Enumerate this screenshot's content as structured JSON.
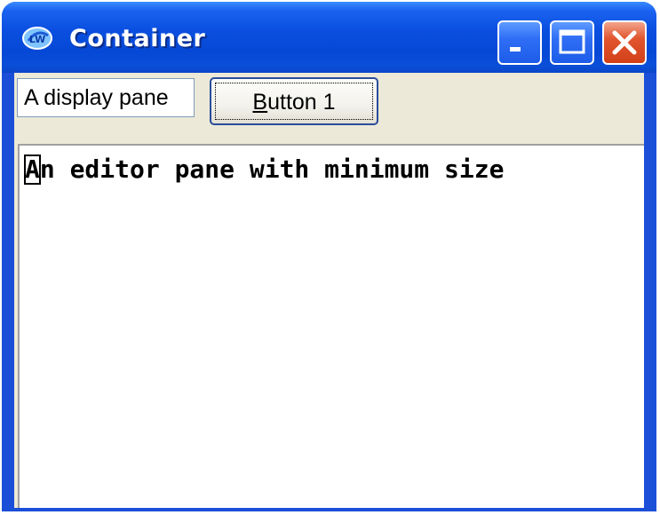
{
  "window": {
    "title": "Container",
    "app_icon": "labwindows-icon",
    "controls": {
      "minimize_icon": "minimize-icon",
      "maximize_icon": "maximize-icon",
      "close_icon": "close-icon"
    },
    "colors": {
      "titlebar": "#0648d6",
      "client_bg": "#ece9d8",
      "close_button": "#d34018"
    }
  },
  "toolbar": {
    "display_pane_text": "A display pane",
    "button1_mnemonic": "B",
    "button1_rest": "utton 1"
  },
  "editor": {
    "text": "An editor pane with minimum size"
  }
}
